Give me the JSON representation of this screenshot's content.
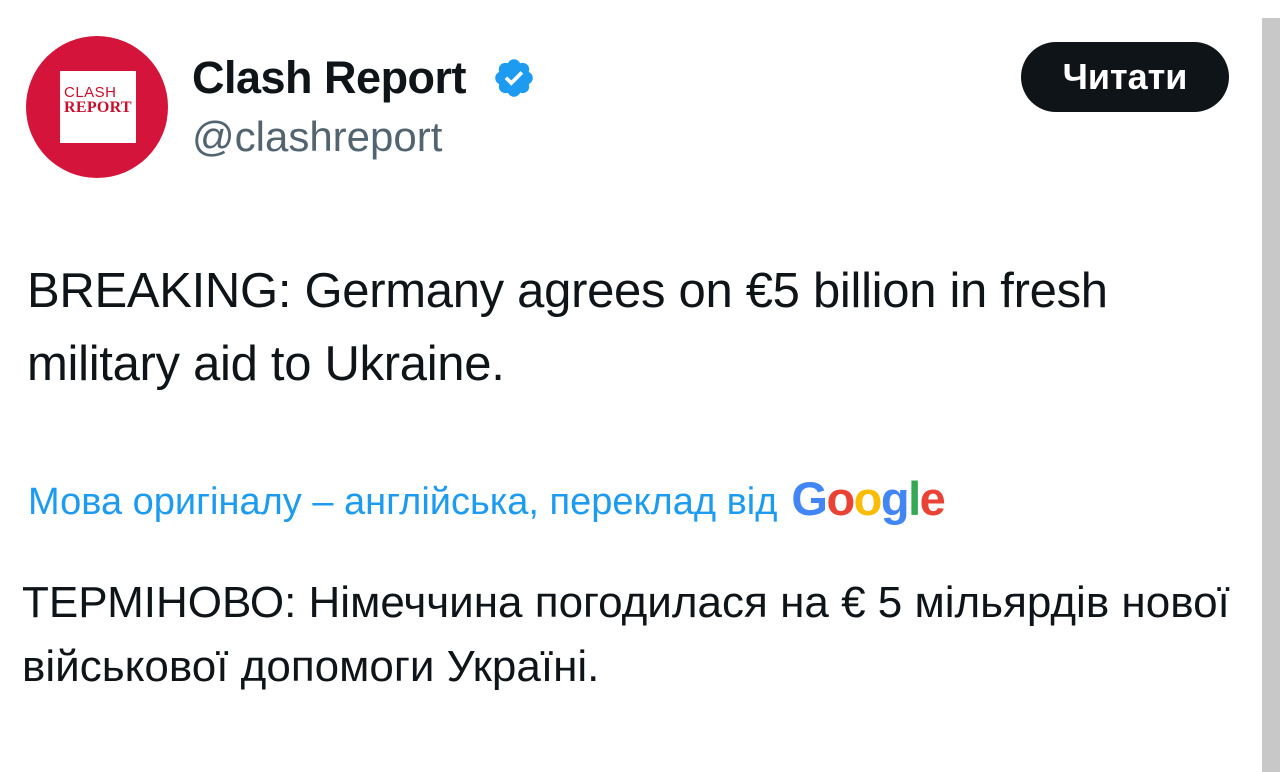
{
  "author": {
    "display_name": "Clash Report",
    "handle": "@clashreport",
    "verified": true,
    "avatar": {
      "line1": "CLASH",
      "line2": "REPORT",
      "bg_color": "#d4143a"
    }
  },
  "actions": {
    "follow_label": "Читати"
  },
  "tweet": {
    "text": "BREAKING: Germany agrees on €5 billion in fresh military aid to Ukraine."
  },
  "translation": {
    "label": "Мова оригіналу – англійська, переклад від",
    "provider": {
      "letter1": "G",
      "letter2": "o",
      "letter3": "o",
      "letter4": "g",
      "letter5": "l",
      "letter6": "e"
    },
    "text": "ТЕРМІНОВО: Німеччина погодилася на € 5 мільярдів нової військової допомоги Україні."
  },
  "colors": {
    "accent": "#1d9bf0",
    "text": "#0f1419",
    "secondary_text": "#536471",
    "button_bg": "#0f1419"
  },
  "icons": {
    "verified": "verified-badge-icon"
  }
}
